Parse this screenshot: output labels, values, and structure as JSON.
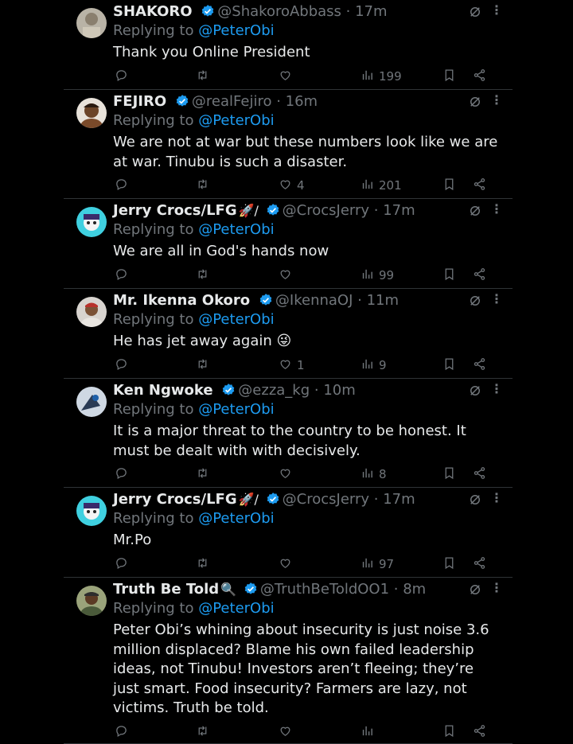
{
  "colors": {
    "background": "#000000",
    "text": "#e7e9ea",
    "muted": "#71767b",
    "link": "#1d9bf0",
    "verified": "#1d9bf0",
    "divider": "#2f3336"
  },
  "replying_label": "Replying to",
  "tweets": [
    {
      "name": "SHAKORO",
      "handle": "@ShakoroAbbass",
      "time": "17m",
      "emojis": "",
      "mention": "@PeterObi",
      "text": "Thank you Online President",
      "replies": "",
      "retweets": "",
      "likes": "",
      "views": "199"
    },
    {
      "name": "FEJIRO",
      "handle": "@realFejiro",
      "time": "16m",
      "emojis": "",
      "mention": "@PeterObi",
      "text": "We are not at war but these numbers look like we are at war. Tinubu is such a disaster.",
      "replies": "",
      "retweets": "",
      "likes": "4",
      "views": "201"
    },
    {
      "name": "Jerry Crocs/LFG",
      "handle": "@CrocsJerry",
      "time": "17m",
      "emojis": "🚀/",
      "mention": "@PeterObi",
      "text": "We are all in God's hands now",
      "replies": "",
      "retweets": "",
      "likes": "",
      "views": "99"
    },
    {
      "name": "Mr. Ikenna Okoro",
      "handle": "@IkennaOJ",
      "time": "11m",
      "emojis": "",
      "mention": "@PeterObi",
      "text": "He has jet away again 😜",
      "replies": "",
      "retweets": "",
      "likes": "1",
      "views": "9"
    },
    {
      "name": "Ken Ngwoke",
      "handle": "@ezza_kg",
      "time": "10m",
      "emojis": "",
      "mention": "@PeterObi",
      "text": "It is a major threat to the country to be honest. It must be dealt with with decisively.",
      "replies": "",
      "retweets": "",
      "likes": "",
      "views": "8"
    },
    {
      "name": "Jerry Crocs/LFG",
      "handle": "@CrocsJerry",
      "time": "17m",
      "emojis": "🚀/",
      "mention": "@PeterObi",
      "text": "Mr.Po",
      "replies": "",
      "retweets": "",
      "likes": "",
      "views": "97"
    },
    {
      "name": "Truth Be Told",
      "handle": "@TruthBeToldOO1",
      "time": "8m",
      "emojis": "🔍",
      "mention": "@PeterObi",
      "text": "Peter Obi’s whining about insecurity is just noise 3.6 million displaced? Blame his own failed leadership ideas, not Tinubu! Investors aren’t fleeing; they’re just smart. Food insecurity? Farmers are lazy, not victims. Truth be told.",
      "replies": "",
      "retweets": "",
      "likes": "",
      "views": ""
    }
  ]
}
